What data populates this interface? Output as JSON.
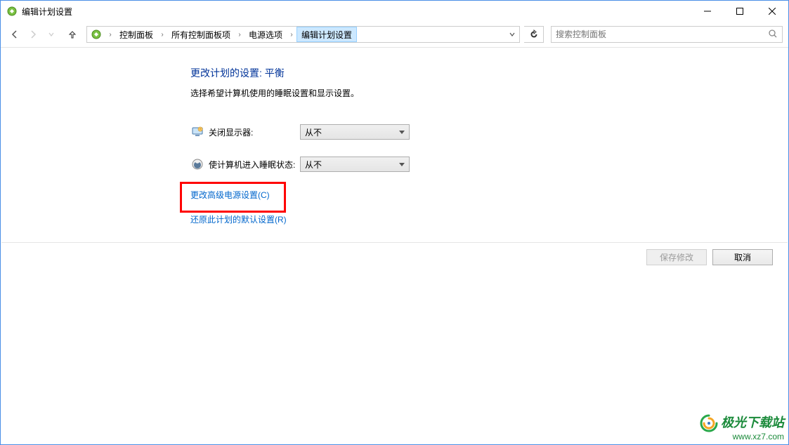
{
  "window": {
    "title": "编辑计划设置",
    "controls": {
      "min": "—",
      "max": "☐",
      "close": "✕"
    }
  },
  "nav": {
    "breadcrumbs": [
      "控制面板",
      "所有控制面板项",
      "电源选项",
      "编辑计划设置"
    ]
  },
  "search": {
    "placeholder": "搜索控制面板"
  },
  "content": {
    "heading": "更改计划的设置: 平衡",
    "subtext": "选择希望计算机使用的睡眠设置和显示设置。",
    "rows": [
      {
        "label": "关闭显示器:",
        "value": "从不"
      },
      {
        "label": "使计算机进入睡眠状态:",
        "value": "从不"
      }
    ],
    "links": {
      "advanced": "更改高级电源设置(C)",
      "restore": "还原此计划的默认设置(R)"
    }
  },
  "footer": {
    "save": "保存修改",
    "cancel": "取消"
  },
  "watermark": {
    "title": "极光下载站",
    "url": "www.xz7.com"
  }
}
